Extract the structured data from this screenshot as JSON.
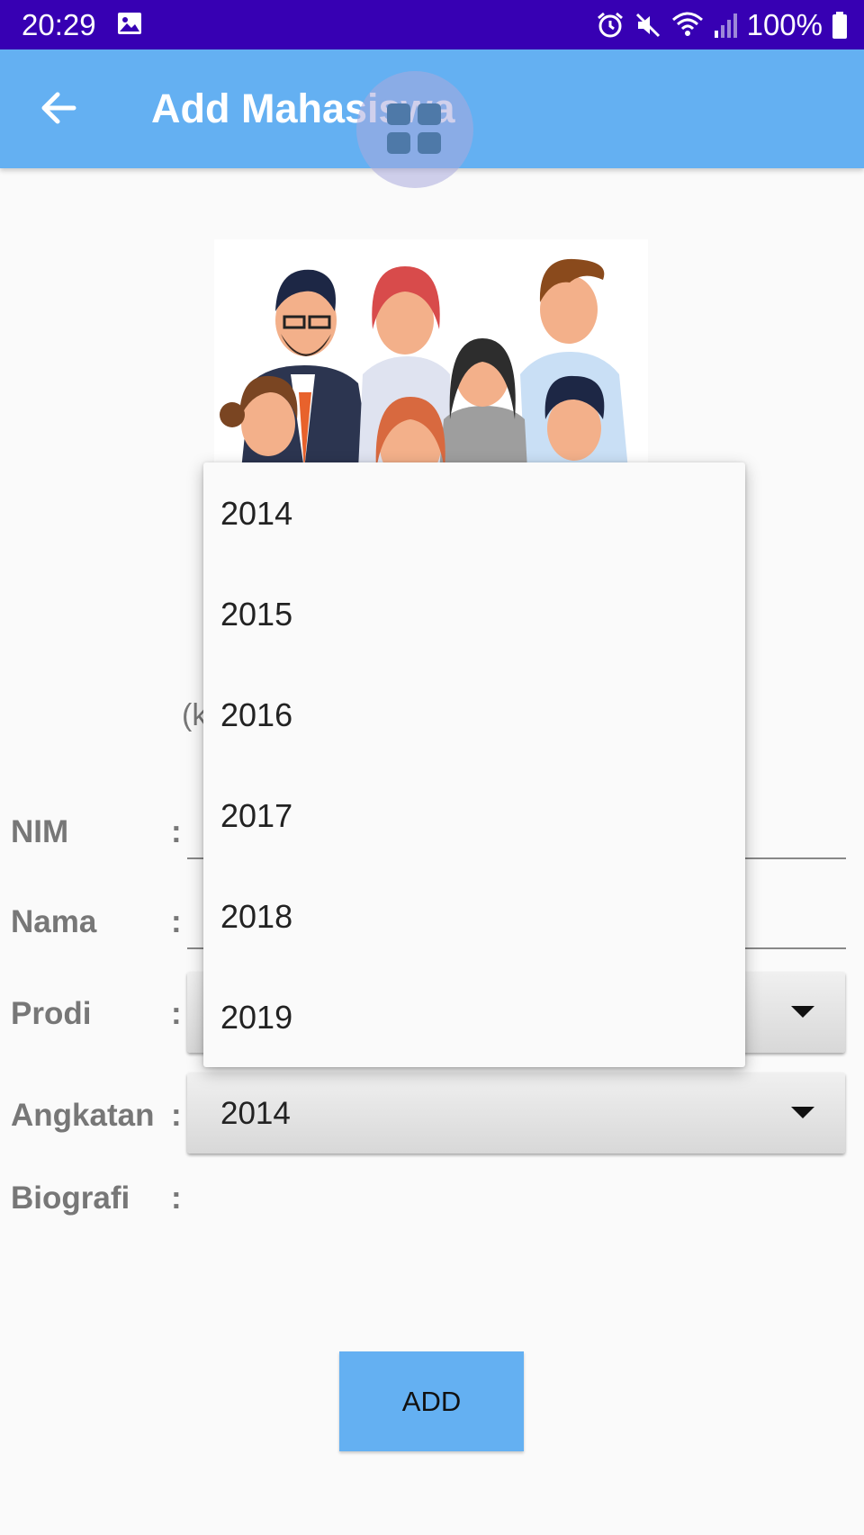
{
  "status_bar": {
    "time": "20:29",
    "battery": "100%"
  },
  "app_bar": {
    "title": "Add Mahasiswa"
  },
  "peek_text": "(k",
  "form": {
    "nim_label": "NIM",
    "nama_label": "Nama",
    "prodi_label": "Prodi",
    "angkatan_label": "Angkatan",
    "biografi_label": "Biografi",
    "colon": ":",
    "angkatan_value": "2014"
  },
  "dropdown": {
    "options": [
      "2014",
      "2015",
      "2016",
      "2017",
      "2018",
      "2019"
    ]
  },
  "add_button": "ADD",
  "colors": {
    "status_bar": "#3700b3",
    "app_bar": "#64b0f2",
    "button": "#64b0f2"
  }
}
